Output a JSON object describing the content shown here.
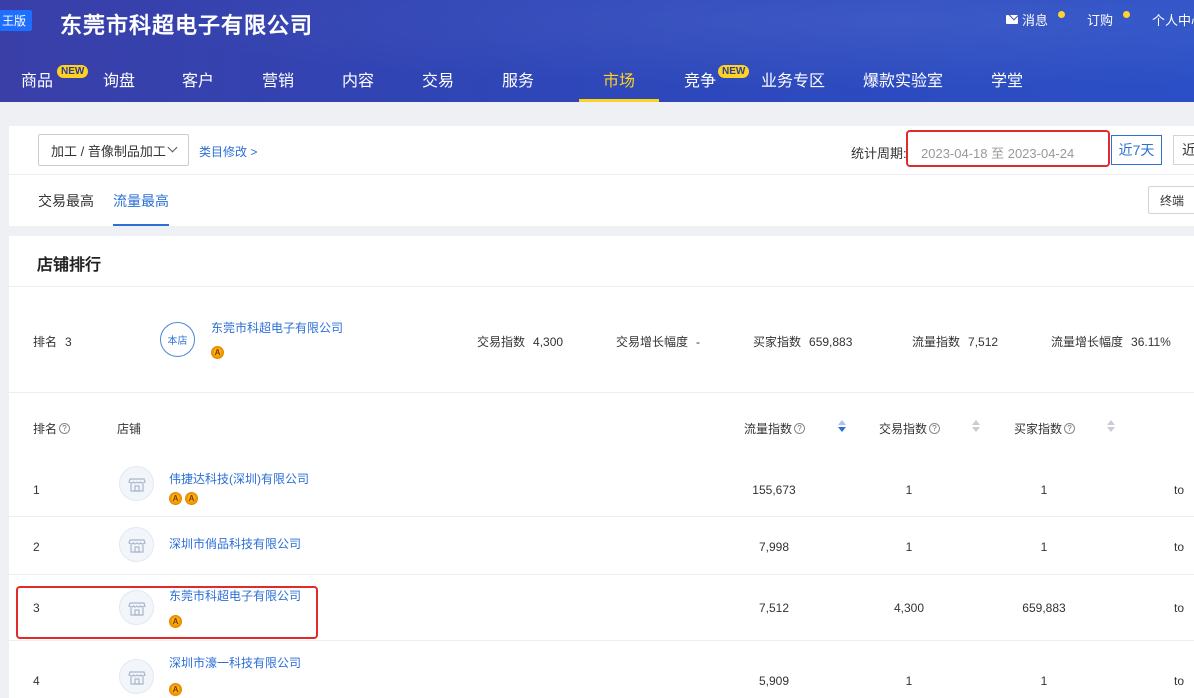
{
  "header": {
    "edition_badge": "王版",
    "company": "东莞市科超电子有限公司",
    "links": [
      {
        "label": "消息",
        "icon": "mail-icon"
      },
      {
        "label": "订购"
      },
      {
        "label": "个人中心"
      }
    ],
    "nav": [
      {
        "label": "商品",
        "badge": "NEW"
      },
      {
        "label": "询盘"
      },
      {
        "label": "客户"
      },
      {
        "label": "营销"
      },
      {
        "label": "内容"
      },
      {
        "label": "交易"
      },
      {
        "label": "服务"
      },
      {
        "label": "市场",
        "active": true
      },
      {
        "label": "竞争",
        "badge": "NEW"
      },
      {
        "label": "业务专区"
      },
      {
        "label": "爆款实验室"
      },
      {
        "label": "学堂"
      }
    ]
  },
  "filters": {
    "category": "加工 / 音像制品加工",
    "category_edit": "类目修改 >",
    "period_label": "统计周期:",
    "date_range": "2023-04-18 至 2023-04-24",
    "btn_7d": "近7天",
    "btn_30d": "近",
    "tabs": [
      "交易最高",
      "流量最高"
    ],
    "active_tab": 1,
    "device": "终端"
  },
  "ranking": {
    "title": "店铺排行",
    "summary": {
      "rank_label": "排名",
      "rank_value": "3",
      "store_badge": "本店",
      "company": "东莞市科超电子有限公司",
      "metrics": [
        {
          "label": "交易指数",
          "value": "4,300"
        },
        {
          "label": "交易增长幅度",
          "value": "-"
        },
        {
          "label": "买家指数",
          "value": "659,883"
        },
        {
          "label": "流量指数",
          "value": "7,512"
        },
        {
          "label": "流量增长幅度",
          "value": "36.11%"
        }
      ]
    },
    "columns": {
      "rank": "排名",
      "store": "店铺",
      "traffic": "流量指数",
      "trade": "交易指数",
      "buyer": "买家指数"
    },
    "medal_letter": "A",
    "rows": [
      {
        "rank": "1",
        "name": "伟捷达科技(深圳)有限公司",
        "medals": 2,
        "traffic": "155,673",
        "trade": "1",
        "buyer": "1",
        "extra": "to"
      },
      {
        "rank": "2",
        "name": "深圳市俏品科技有限公司",
        "medals": 0,
        "traffic": "7,998",
        "trade": "1",
        "buyer": "1",
        "extra": "to"
      },
      {
        "rank": "3",
        "name": "东莞市科超电子有限公司",
        "medals": 1,
        "traffic": "7,512",
        "trade": "4,300",
        "buyer": "659,883",
        "extra": "to"
      },
      {
        "rank": "4",
        "name": "深圳市濠一科技有限公司",
        "medals": 1,
        "traffic": "5,909",
        "trade": "1",
        "buyer": "1",
        "extra": "to"
      }
    ]
  },
  "colors": {
    "header_bg": "#2e46b8",
    "accent": "#2c6fd6",
    "nav_active": "#ffd21f",
    "highlight": "#e12a2a"
  }
}
